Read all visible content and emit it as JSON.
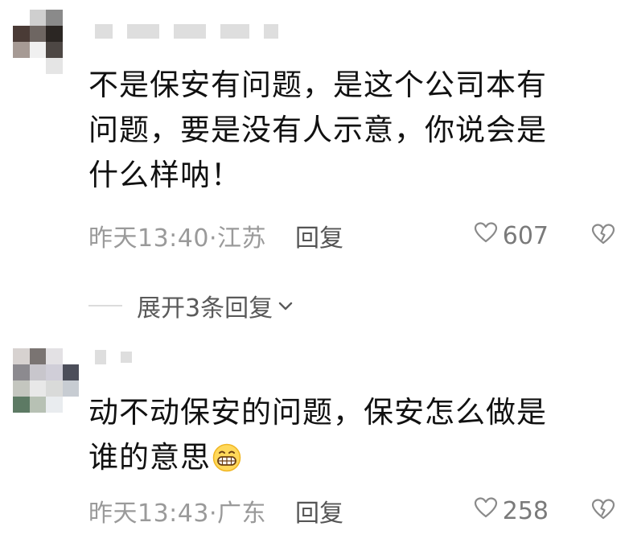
{
  "comments": [
    {
      "text": "不是保安有问题，是这个公司本有\n问题，要是没有人示意，你说会是\n什么样呐！",
      "time": "昨天13:40·江苏",
      "reply_label": "回复",
      "likes": "607",
      "avatar_colors": [
        "#ffffff",
        "#cfcfcf",
        "#8a8a8a",
        "#ffffff",
        "#4a3b36",
        "#6e6662",
        "#2b2623",
        "#ffffff",
        "#a69a94",
        "#f0f0f0",
        "#4d4744",
        "#ffffff",
        "#ffffff",
        "#ffffff",
        "#e5e5e5",
        "#ffffff"
      ]
    },
    {
      "text": "动不动保安的问题，保安怎么做是\n谁的意思",
      "emoji": "grin-emoji",
      "time": "昨天13:43·广东",
      "reply_label": "回复",
      "likes": "258",
      "avatar_colors": [
        "#d7d2d0",
        "#7a7472",
        "#e3e1e4",
        "#ffffff",
        "#8c8a8f",
        "#c8c6cc",
        "#d0ced8",
        "#4c4e5a",
        "#c4c6bf",
        "#e8e8e8",
        "#d9dad9",
        "#c7ccd2",
        "#5d7a64",
        "#b7c1b4",
        "#e9ecef",
        "#ffffff"
      ]
    }
  ],
  "expand": {
    "label": "展开3条回复"
  },
  "icons": {
    "heart": "heart-outline-icon",
    "dislike": "broken-heart-icon",
    "chevron": "chevron-down-icon"
  },
  "colors": {
    "text": "#111111",
    "meta": "#9a9a9a",
    "likes": "#7a7a7a"
  }
}
